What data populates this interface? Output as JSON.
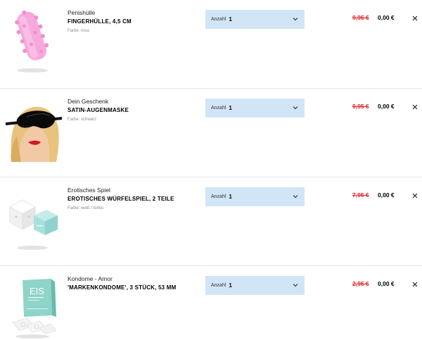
{
  "cart": {
    "items": [
      {
        "subtitle": "Penishülle",
        "title": "FINGERHÜLLE, 4,5 CM",
        "variant": "Farbe: rosa",
        "quantity_label": "Anzahl",
        "quantity": "1",
        "old_price": "9,95 €",
        "new_price": "0,00 €",
        "image_icon": "pink-sleeve-image"
      },
      {
        "subtitle": "Dein Geschenk",
        "title": "SATIN-AUGENMASKE",
        "variant": "Farbe: schwarz",
        "quantity_label": "Anzahl",
        "quantity": "1",
        "old_price": "9,95 €",
        "new_price": "0,00 €",
        "image_icon": "eye-mask-image"
      },
      {
        "subtitle": "Erotisches Spiel",
        "title": "EROTISCHES WÜRFELSPIEL, 2 TEILE",
        "variant": "Farbe: weiß / türkis",
        "quantity_label": "Anzahl",
        "quantity": "1",
        "old_price": "7,95 €",
        "new_price": "0,00 €",
        "image_icon": "dice-image"
      },
      {
        "subtitle": "Kondome - Amor",
        "title": "'MARKENKONDOME', 3 STÜCK, 53 MM",
        "variant": "",
        "quantity_label": "Anzahl",
        "quantity": "1",
        "old_price": "2,95 €",
        "new_price": "0,00 €",
        "image_icon": "condom-box-image",
        "image_text": "EIS"
      }
    ]
  },
  "colors": {
    "quantity_bg": "#d2e5f7",
    "old_price": "#e4232c",
    "divider": "#e6e6e6"
  }
}
